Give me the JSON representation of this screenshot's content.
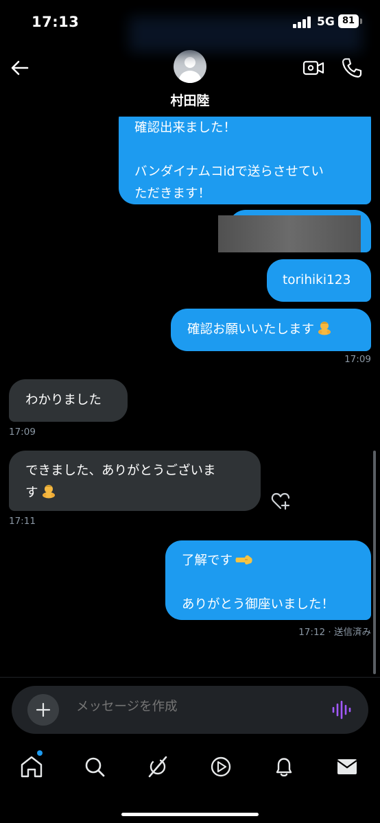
{
  "status_bar": {
    "time": "17:13",
    "network": "5G",
    "battery": "81"
  },
  "header": {
    "contact_name": "村田陸"
  },
  "messages": [
    {
      "dir": "out",
      "lines": [
        "確認出来ました！",
        "",
        "バンダイナムコidで送らさせてい",
        "ただきます！"
      ]
    },
    {
      "dir": "out",
      "redacted": true
    },
    {
      "dir": "out",
      "lines": [
        "torihiki123"
      ]
    },
    {
      "dir": "out",
      "lines": [
        "確認お願いいたします"
      ],
      "emoji": "bowing-person-emoji",
      "time": "17:09"
    },
    {
      "dir": "in",
      "lines": [
        "わかりました"
      ],
      "time": "17:09"
    },
    {
      "dir": "in",
      "lines": [
        "できました、ありがとうございま",
        "す"
      ],
      "emoji": "bowing-person-emoji",
      "time": "17:11"
    },
    {
      "dir": "out",
      "lines": [
        "了解です",
        "",
        "ありがとう御座いました！"
      ],
      "emoji": "pointing-left-emoji",
      "time": "17:12 · 送信済み"
    }
  ],
  "composer": {
    "placeholder": "メッセージを作成"
  },
  "tabs": [
    "home-icon",
    "search-icon",
    "grok-icon",
    "video-icon",
    "notifications-icon",
    "messages-icon"
  ],
  "colors": {
    "outgoing": "#1d9bf0",
    "incoming": "#2f3336",
    "background": "#000000"
  }
}
